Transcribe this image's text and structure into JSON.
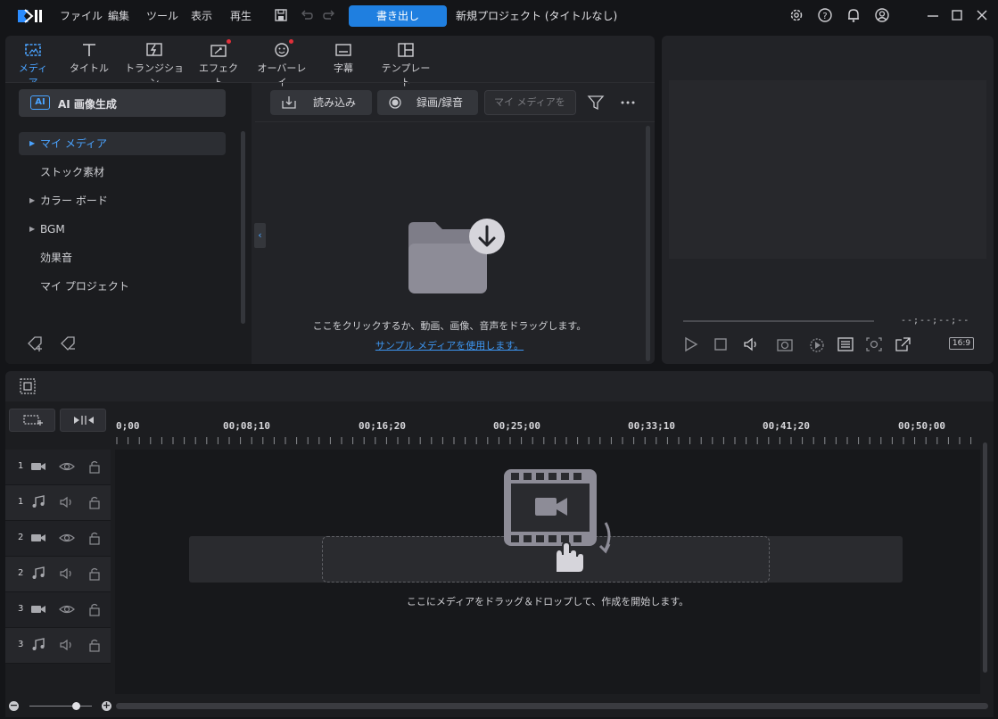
{
  "titlebar": {
    "menu": [
      "ファイル",
      "編集",
      "ツール",
      "表示",
      "再生"
    ],
    "export_label": "書き出し",
    "project_title": "新規プロジェクト (タイトルなし)",
    "icons": [
      "save-icon",
      "undo-icon",
      "redo-icon",
      "settings-icon",
      "help-icon",
      "notification-icon",
      "account-icon",
      "minimize-icon",
      "maximize-icon",
      "close-icon"
    ]
  },
  "library": {
    "tabs": [
      {
        "label": "メディア",
        "icon": "media-icon",
        "active": true
      },
      {
        "label": "タイトル",
        "icon": "title-icon"
      },
      {
        "label": "トランジション",
        "icon": "transition-icon"
      },
      {
        "label": "エフェクト",
        "icon": "effect-icon",
        "badge": true
      },
      {
        "label": "オーバーレイ",
        "icon": "overlay-icon",
        "badge": true
      },
      {
        "label": "字幕",
        "icon": "subtitle-icon"
      },
      {
        "label": "テンプレート",
        "icon": "template-icon"
      }
    ],
    "ai_label": "AI 画像生成",
    "ai_badge": "AI",
    "nav": [
      {
        "label": "マイ メディア",
        "arrow": true,
        "selected": true
      },
      {
        "label": "ストック素材",
        "arrow": false
      },
      {
        "label": "カラー ボード",
        "arrow": true
      },
      {
        "label": "BGM",
        "arrow": true
      },
      {
        "label": "効果音",
        "arrow": false
      },
      {
        "label": "マイ プロジェクト",
        "arrow": false
      }
    ],
    "import_label": "読み込み",
    "record_label": "録画/録音",
    "search_placeholder": "マイ メディアを",
    "empty_hint": "ここをクリックするか、動画、画像、音声をドラッグします。",
    "sample_link": "サンプル メディアを使用します。"
  },
  "preview": {
    "timecode": "--;--;--;--",
    "aspect": "16:9"
  },
  "timeline": {
    "ruler": [
      "0;00",
      "00;08;10",
      "00;16;20",
      "00;25;00",
      "00;33;10",
      "00;41;20",
      "00;50;00"
    ],
    "tracks": [
      {
        "num": "1",
        "type": "video"
      },
      {
        "num": "1",
        "type": "audio"
      },
      {
        "num": "2",
        "type": "video"
      },
      {
        "num": "2",
        "type": "audio"
      },
      {
        "num": "3",
        "type": "video"
      },
      {
        "num": "3",
        "type": "audio"
      }
    ],
    "drop_hint": "ここにメディアをドラッグ＆ドロップして、作成を開始します。",
    "zoom_minus": "−",
    "zoom_plus": "+"
  },
  "colors": {
    "accent": "#1f7fe0",
    "link": "#3d96f2",
    "badge": "#e0303a",
    "background": "#141518",
    "panel": "#222327"
  }
}
